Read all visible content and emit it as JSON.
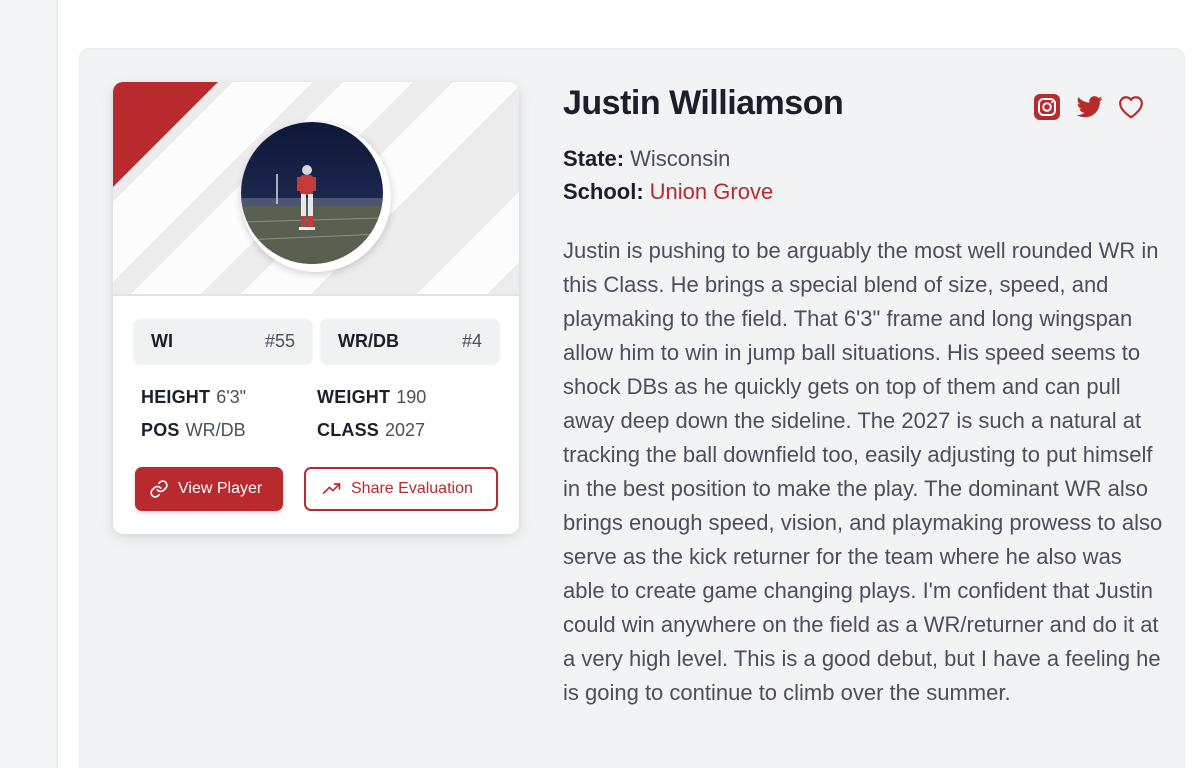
{
  "player": {
    "name": "Justin Williamson",
    "state_label": "State:",
    "state": "Wisconsin",
    "school_label": "School:",
    "school": "Union Grove",
    "bio": "Justin is pushing to be arguably the most well rounded WR in this Class. He brings a special blend of size, speed, and playmaking to the field. That 6'3\" frame and long wingspan allow him to win in jump ball situations. His speed seems to shock DBs as he quickly gets on top of them and can pull away deep down the sideline. The 2027 is such a natural at tracking the ball downfield too, easily adjusting to put himself in the best position to make the play. The dominant WR also brings enough speed, vision, and playmaking prowess to also serve as the kick returner for the team where he also was able to create game changing plays. I'm confident that Justin could win anywhere on the field as a WR/returner and do it at a very high level. This is a good debut, but I have a feeling he is going to continue to climb over the summer."
  },
  "card": {
    "state_chip": {
      "label": "WI",
      "rank": "#55"
    },
    "position_chip": {
      "label": "WR/DB",
      "rank": "#4"
    },
    "stats": {
      "height_label": "HEIGHT",
      "height": "6'3\"",
      "weight_label": "WEIGHT",
      "weight": "190",
      "pos_label": "POS",
      "pos": "WR/DB",
      "class_label": "CLASS",
      "class": "2027"
    },
    "buttons": {
      "view_player": "View Player",
      "share_evaluation": "Share Evaluation"
    }
  },
  "icons": {
    "social": [
      "instagram-icon",
      "twitter-icon",
      "heart-icon"
    ],
    "buttons": [
      "link-icon",
      "trending-up-icon"
    ]
  },
  "colors": {
    "accent": "#b92a2e",
    "panel_bg": "#f2f3f5",
    "text_dark": "#1b1f2a",
    "text_muted": "#4a4f5a"
  }
}
